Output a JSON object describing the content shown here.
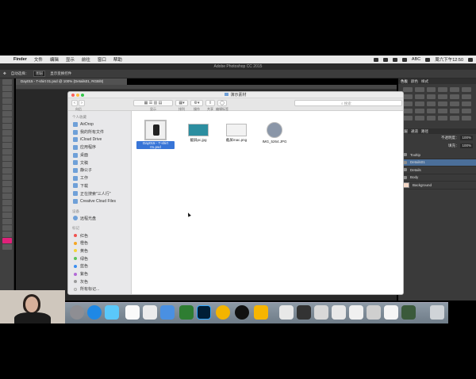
{
  "menubar": {
    "app": "Finder",
    "items": [
      "文件",
      "编辑",
      "显示",
      "前往",
      "窗口",
      "帮助"
    ],
    "right_text": "ABC",
    "clock": "周六下午12:50"
  },
  "photoshop": {
    "window_title": "Adobe Photoshop CC 2015",
    "options": {
      "auto_select": "自动选择：",
      "auto_select_value": "图层",
      "show_transform": "显示变换控件"
    },
    "doc_tab": "Day015 - T-shirt 01.psd @ 100% (Details01, RGB/8)",
    "panel_tabs_top": [
      "色板",
      "颜色",
      "样式"
    ],
    "panel_tabs_layers": [
      "图层",
      "通道",
      "路径"
    ],
    "layers_opacity_label": "不透明度：",
    "layers_opacity_value": "100%",
    "layers_fill_label": "填充：",
    "layers_fill_value": "100%",
    "layers": [
      {
        "name": "Tooltip",
        "type": "folder",
        "selected": false
      },
      {
        "name": "Details01",
        "type": "folder",
        "selected": true
      },
      {
        "name": "Details",
        "type": "folder",
        "selected": false
      },
      {
        "name": "Body",
        "type": "folder",
        "selected": false
      },
      {
        "name": "Background",
        "type": "image",
        "selected": false
      }
    ]
  },
  "finder": {
    "window_title": "演示素材",
    "toolbar": {
      "back_caption": "向后",
      "view_caption": "显示",
      "arrange_caption": "排列",
      "action_caption": "操作",
      "share_caption": "共享",
      "tags_caption": "编辑标签",
      "search_placeholder": "搜索"
    },
    "sidebar": {
      "favorites_header": "个人收藏",
      "favorites": [
        "AirDrop",
        "我的所有文件",
        "iCloud Drive",
        "应用程序",
        "桌面",
        "文稿",
        "静公子",
        "工作",
        "下载",
        "正在搜索\"三人行\"",
        "Creative Cloud Files"
      ],
      "devices_header": "设备",
      "devices": [
        "远程光盘"
      ],
      "tags_header": "标记",
      "tags": [
        {
          "name": "红色",
          "color": "#f0524f"
        },
        {
          "name": "橙色",
          "color": "#f5a623"
        },
        {
          "name": "黄色",
          "color": "#f3d33b"
        },
        {
          "name": "绿色",
          "color": "#5cc35c"
        },
        {
          "name": "蓝色",
          "color": "#3a8ef0"
        },
        {
          "name": "紫色",
          "color": "#b36ad6"
        },
        {
          "name": "灰色",
          "color": "#9b9b9b"
        },
        {
          "name": "所有标记...",
          "color": "#e0e0e0"
        }
      ]
    },
    "files": [
      {
        "name": "Day015 - T-shirt 01.psd",
        "selected": true
      },
      {
        "name": "截屏pc.jpg",
        "selected": false
      },
      {
        "name": "截屏mac.png",
        "selected": false
      },
      {
        "name": "IMG_5264.JPG",
        "selected": false
      }
    ]
  },
  "colors": {
    "selection": "#3875d7",
    "layer_selected": "#4b6f9a"
  }
}
